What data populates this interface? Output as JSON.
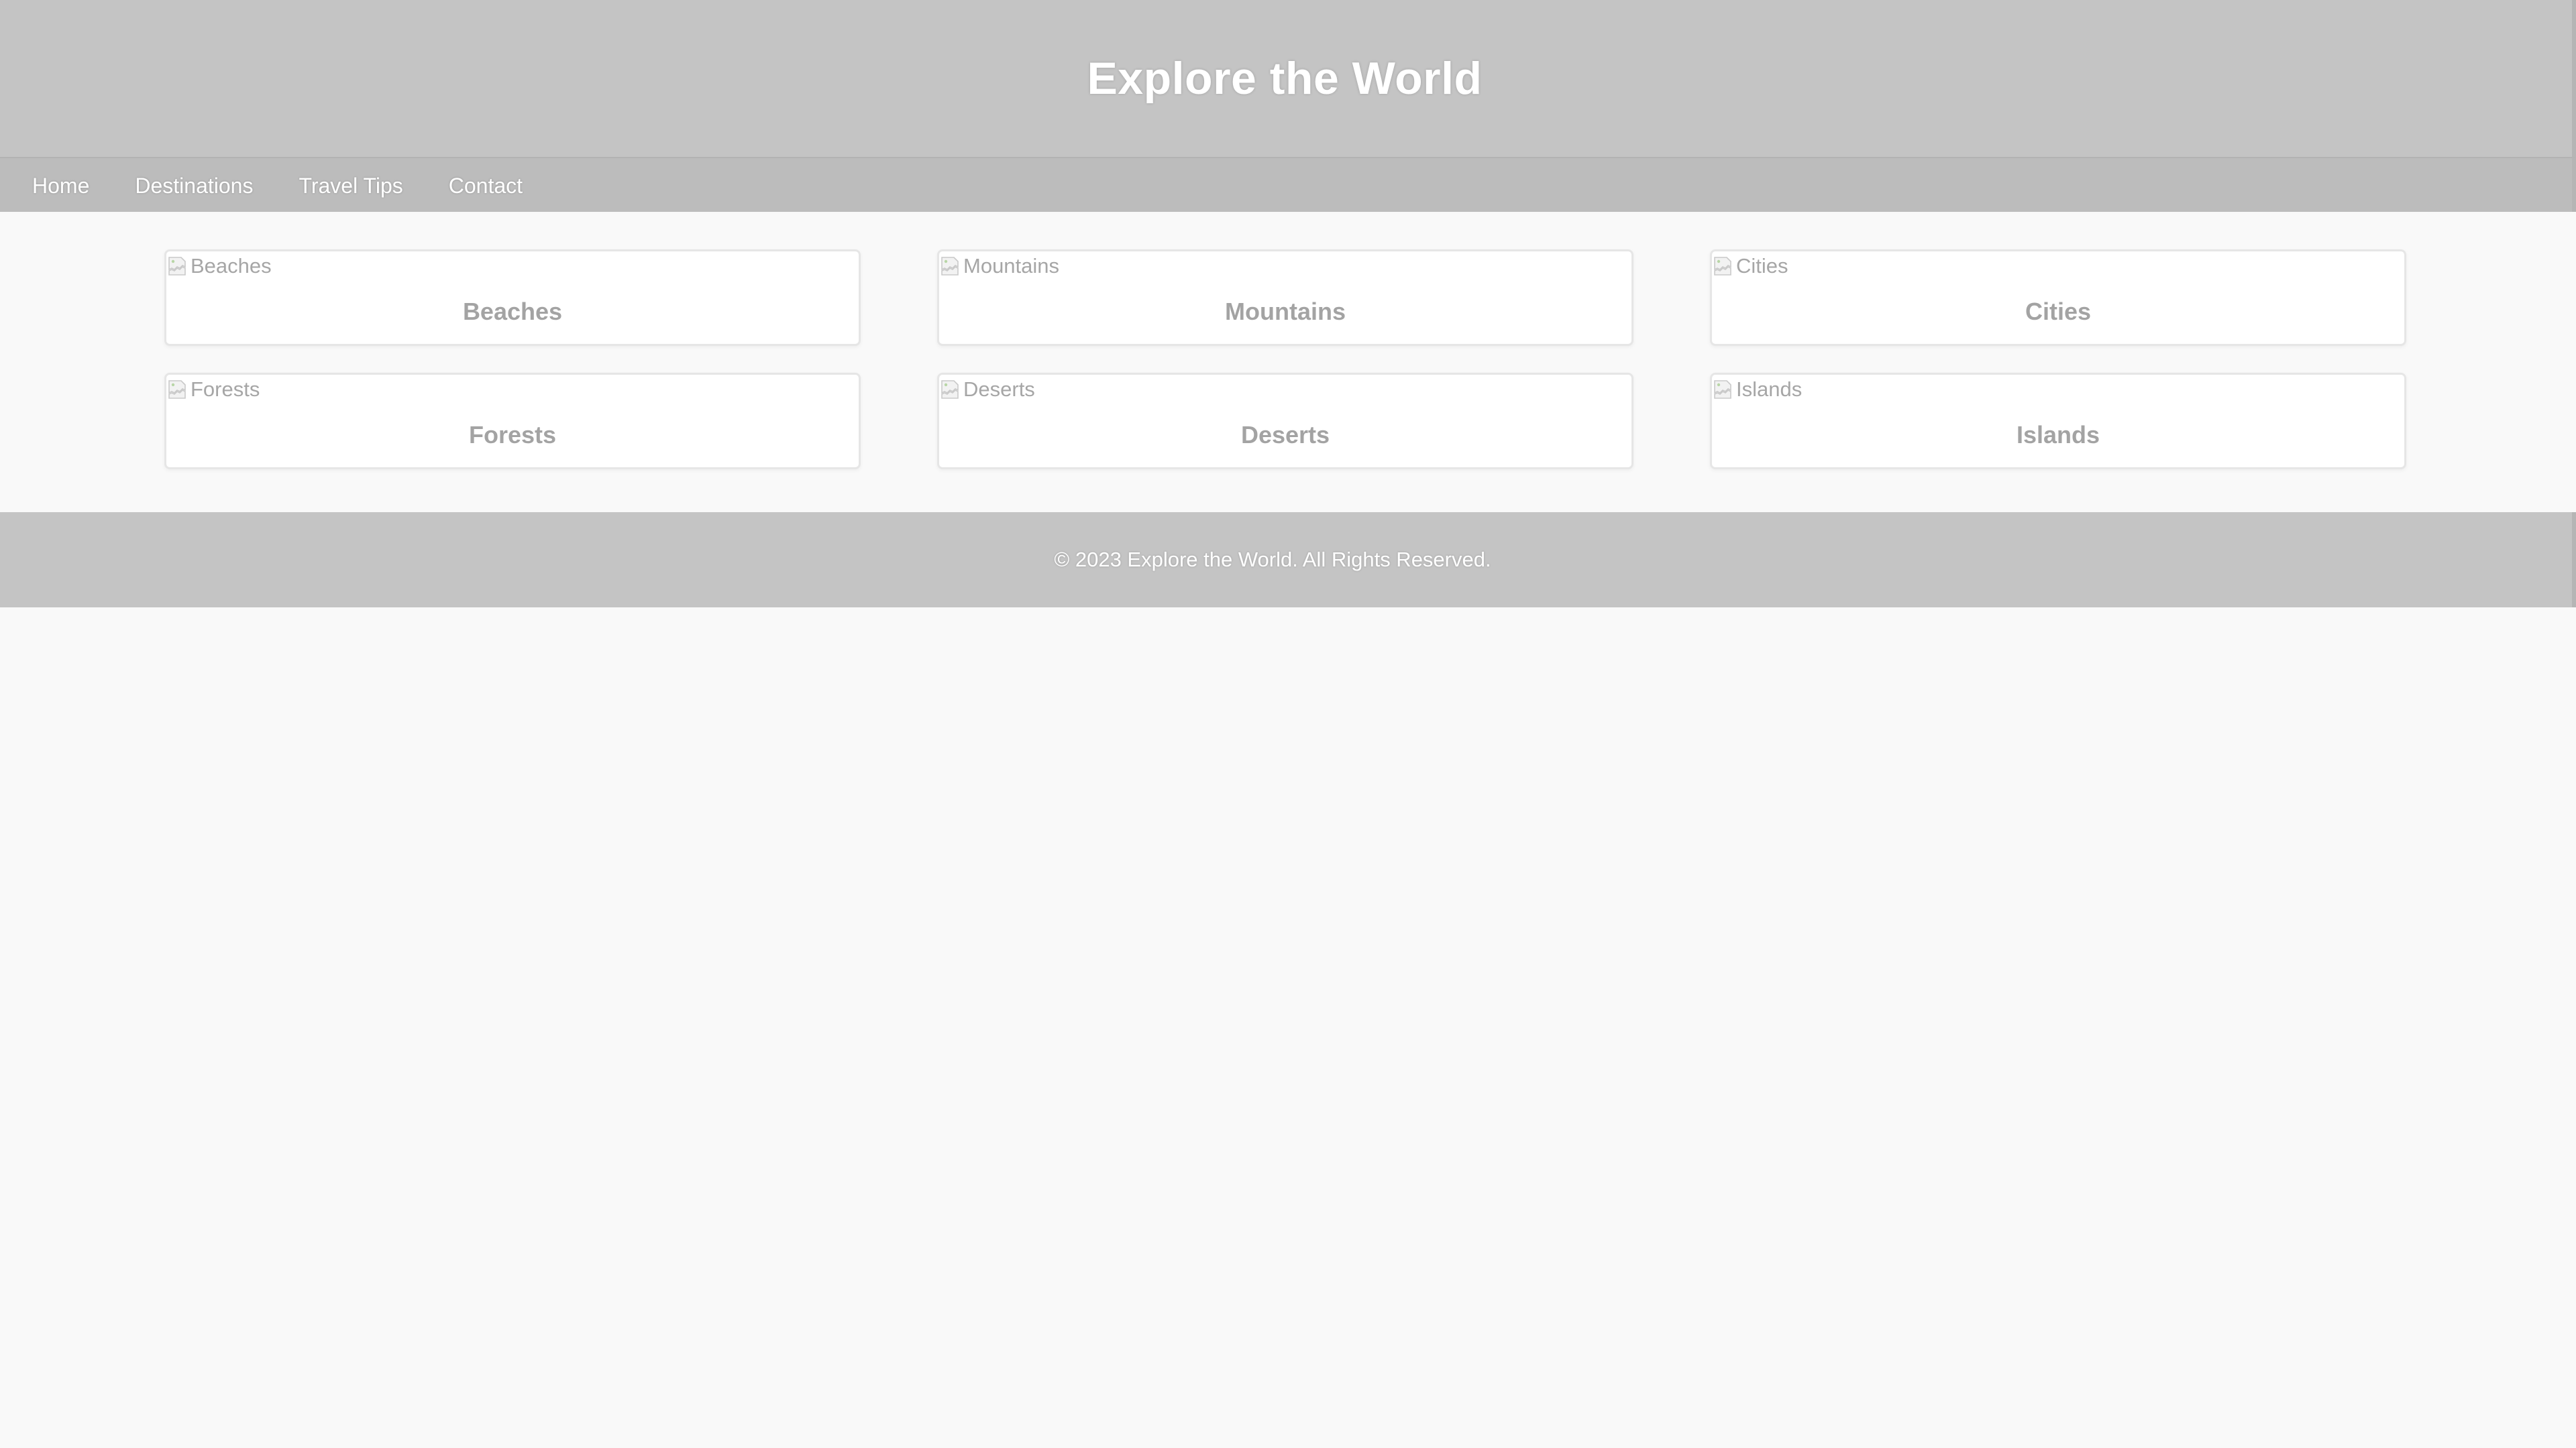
{
  "header": {
    "title": "Explore the World"
  },
  "nav": {
    "items": [
      {
        "label": "Home"
      },
      {
        "label": "Destinations"
      },
      {
        "label": "Travel Tips"
      },
      {
        "label": "Contact"
      }
    ]
  },
  "destinations": [
    {
      "image_alt": "Beaches",
      "title": "Beaches",
      "icon": "broken-image-icon"
    },
    {
      "image_alt": "Mountains",
      "title": "Mountains",
      "icon": "broken-image-icon"
    },
    {
      "image_alt": "Cities",
      "title": "Cities",
      "icon": "broken-image-icon"
    },
    {
      "image_alt": "Forests",
      "title": "Forests",
      "icon": "broken-image-icon"
    },
    {
      "image_alt": "Deserts",
      "title": "Deserts",
      "icon": "broken-image-icon"
    },
    {
      "image_alt": "Islands",
      "title": "Islands",
      "icon": "broken-image-icon"
    }
  ],
  "footer": {
    "text": "© 2023 Explore the World. All Rights Reserved."
  },
  "colors": {
    "header_bg": "#c4c4c4",
    "nav_bg": "#bcbcbc",
    "page_bg": "#f9f9f9",
    "card_bg": "#ffffff",
    "card_text": "#a3a3a3",
    "header_text": "#ffffff"
  }
}
